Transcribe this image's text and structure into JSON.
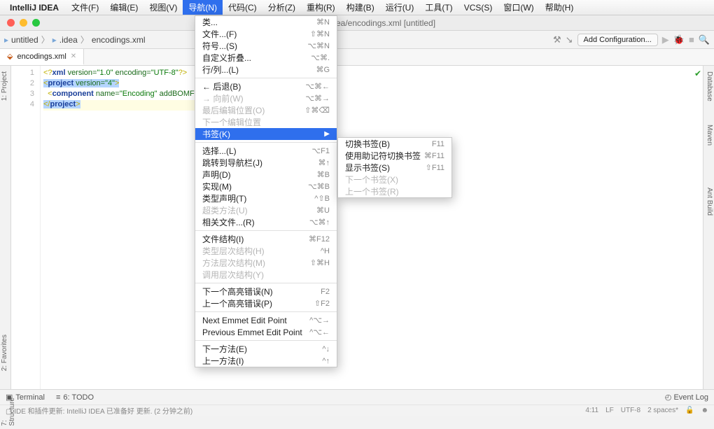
{
  "menubar": {
    "app": "IntelliJ IDEA",
    "items": [
      "文件(F)",
      "编辑(E)",
      "视图(V)",
      "导航(N)",
      "代码(C)",
      "分析(Z)",
      "重构(R)",
      "构建(B)",
      "运行(U)",
      "工具(T)",
      "VCS(S)",
      "窗口(W)",
      "帮助(H)"
    ]
  },
  "window_title": "[untitled] - .../.idea/encodings.xml [untitled]",
  "breadcrumb": {
    "root": "untitled",
    "folder": ".idea",
    "file": "encodings.xml"
  },
  "add_cfg": "Add Configuration...",
  "tab": {
    "label": "encodings.xml"
  },
  "code": {
    "lines": [
      "<?xml version=\"1.0\" encoding=\"UTF-8\"?>",
      "<project version=\"4\">",
      "  <component name=\"Encoding\" addBOMFor…",
      "</project>"
    ]
  },
  "left_panels": [
    "1: Project",
    "2: Favorites",
    "7: Structure"
  ],
  "right_panels": [
    "Database",
    "Maven",
    "Ant Build"
  ],
  "bottom_panels": {
    "terminal": "Terminal",
    "todo": "6: TODO",
    "eventlog": "Event Log"
  },
  "status": {
    "msg": "IDE 和插件更新: IntelliJ IDEA 已准备好 更新. (2 分钟之前)",
    "pos": "4:11",
    "le": "LF",
    "enc": "UTF-8",
    "indent": "2 spaces*"
  },
  "nav_menu": [
    {
      "label": "类...",
      "sc": "⌘N"
    },
    {
      "label": "文件...(F)",
      "sc": "⇧⌘N"
    },
    {
      "label": "符号...(S)",
      "sc": "⌥⌘N"
    },
    {
      "label": "自定义折叠...",
      "sc": "⌥⌘."
    },
    {
      "label": "行/列...(L)",
      "sc": "⌘G"
    },
    {
      "sep": true
    },
    {
      "label": "← 后退(B)",
      "sc": "⌥⌘←"
    },
    {
      "label": "→ 向前(W)",
      "sc": "⌥⌘→",
      "disabled": true
    },
    {
      "label": "最后编辑位置(O)",
      "sc": "⇧⌘⌫",
      "disabled": true
    },
    {
      "label": "下一个编辑位置",
      "disabled": true
    },
    {
      "label": "书签(K)",
      "sub": true,
      "hl": true
    },
    {
      "sep": true
    },
    {
      "label": "选择...(L)",
      "sc": "⌥F1"
    },
    {
      "label": "跳转到导航栏(J)",
      "sc": "⌘↑"
    },
    {
      "label": "声明(D)",
      "sc": "⌘B"
    },
    {
      "label": "实现(M)",
      "sc": "⌥⌘B"
    },
    {
      "label": "类型声明(T)",
      "sc": "^⇧B"
    },
    {
      "label": "超类方法(U)",
      "sc": "⌘U",
      "disabled": true
    },
    {
      "label": "相关文件...(R)",
      "sc": "⌥⌘↑"
    },
    {
      "sep": true
    },
    {
      "label": "文件结构(I)",
      "sc": "⌘F12"
    },
    {
      "label": "类型层次结构(H)",
      "sc": "^H",
      "disabled": true
    },
    {
      "label": "方法层次结构(M)",
      "sc": "⇧⌘H",
      "disabled": true
    },
    {
      "label": "调用层次结构(Y)",
      "disabled": true
    },
    {
      "sep": true
    },
    {
      "label": "下一个高亮错误(N)",
      "sc": "F2"
    },
    {
      "label": "上一个高亮错误(P)",
      "sc": "⇧F2"
    },
    {
      "sep": true
    },
    {
      "label": "Next Emmet Edit Point",
      "sc": "^⌥→"
    },
    {
      "label": "Previous Emmet Edit Point",
      "sc": "^⌥←"
    },
    {
      "sep": true
    },
    {
      "label": "下一方法(E)",
      "sc": "^↓"
    },
    {
      "label": "上一方法(I)",
      "sc": "^↑"
    }
  ],
  "bookmark_sub": [
    {
      "label": "切换书签(B)",
      "sc": "F11"
    },
    {
      "label": "使用助记符切换书签",
      "sc": "⌘F11"
    },
    {
      "label": "显示书签(S)",
      "sc": "⇧F11"
    },
    {
      "label": "下一个书签(X)",
      "disabled": true
    },
    {
      "label": "上一个书签(R)",
      "disabled": true
    }
  ]
}
